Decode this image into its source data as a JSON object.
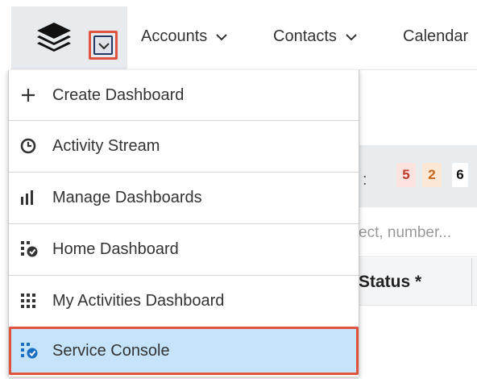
{
  "nav": {
    "logo_icon": "stack-logo-icon",
    "toggle_icon": "chevron-down-icon",
    "items": [
      {
        "label": "Accounts",
        "has_dropdown": true
      },
      {
        "label": "Contacts",
        "has_dropdown": true
      },
      {
        "label": "Calendar",
        "has_dropdown": false
      }
    ]
  },
  "dropdown": {
    "items": [
      {
        "label": "Create Dashboard",
        "icon": "plus-icon"
      },
      {
        "label": "Activity Stream",
        "icon": "clock-icon"
      },
      {
        "label": "Manage Dashboards",
        "icon": "bar-chart-icon"
      },
      {
        "label": "Home Dashboard",
        "icon": "dashboard-check-icon"
      },
      {
        "label": "My Activities Dashboard",
        "icon": "grid-icon"
      },
      {
        "label": "Service Console",
        "icon": "dashboard-check-icon",
        "selected": true
      }
    ]
  },
  "background": {
    "colon": ":",
    "badges": [
      {
        "value": "5",
        "color": "#c0392b"
      },
      {
        "value": "2",
        "color": "#c8651b"
      },
      {
        "value": "6",
        "color": "#111111"
      }
    ],
    "search_placeholder": "ect, number...",
    "column_header": "Status *"
  },
  "colors": {
    "highlight_border": "#e0533e",
    "selected_bg": "#c5e4fb",
    "home_block_bg": "#e7ebee"
  }
}
